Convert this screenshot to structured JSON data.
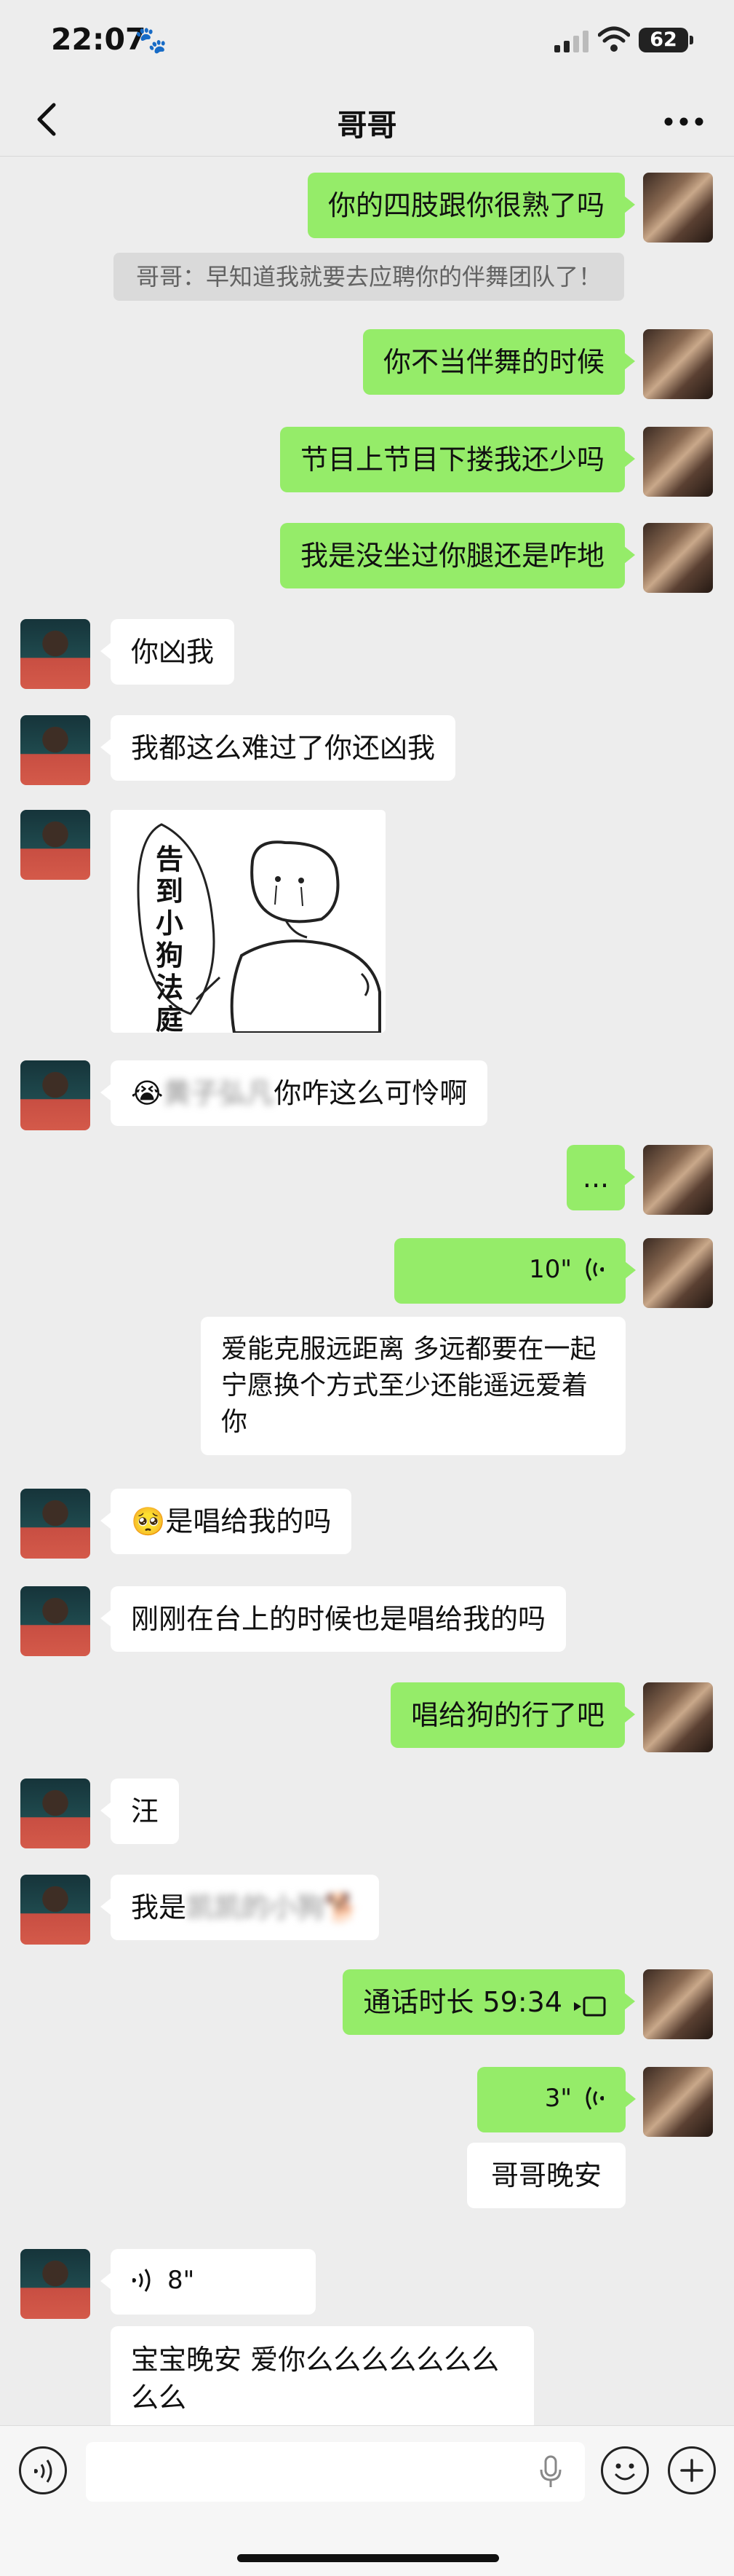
{
  "status": {
    "time": "22:07",
    "battery": "62"
  },
  "nav": {
    "title": "哥哥"
  },
  "messages": {
    "m1": "你的四肢跟你很熟了吗",
    "system": "哥哥：早知道我就要去应聘你的伴舞团队了！",
    "m2": "你不当伴舞的时候",
    "m3": "节目上节目下搂我还少吗",
    "m4": "我是没坐过你腿还是咋地",
    "m5": "你凶我",
    "m6": "我都这么难过了你还凶我",
    "sticker_text": "告到小狗法庭",
    "m7_emoji": "😭",
    "m7_blur": "黄子弘凡",
    "m7_text": "你咋这么可怜啊",
    "m8": "...",
    "voice1": "10\"",
    "voice1_transcript": "爱能克服远距离 多远都要在一起 宁愿换个方式至少还能遥远爱着你",
    "m9_emoji": "🥺",
    "m9_text": "是唱给我的吗",
    "m10": "刚刚在台上的时候也是唱给我的吗",
    "m11": "唱给狗的行了吧",
    "m12": "汪",
    "m13_text": "我是",
    "m13_blur": "凯凯的小狗🐕",
    "call": "通话时长 59:34",
    "voice2": "3\"",
    "voice2_transcript": "哥哥晚安",
    "voice3": "8\"",
    "voice3_transcript": "宝宝晚安 爱你么么么么么么么么么"
  }
}
